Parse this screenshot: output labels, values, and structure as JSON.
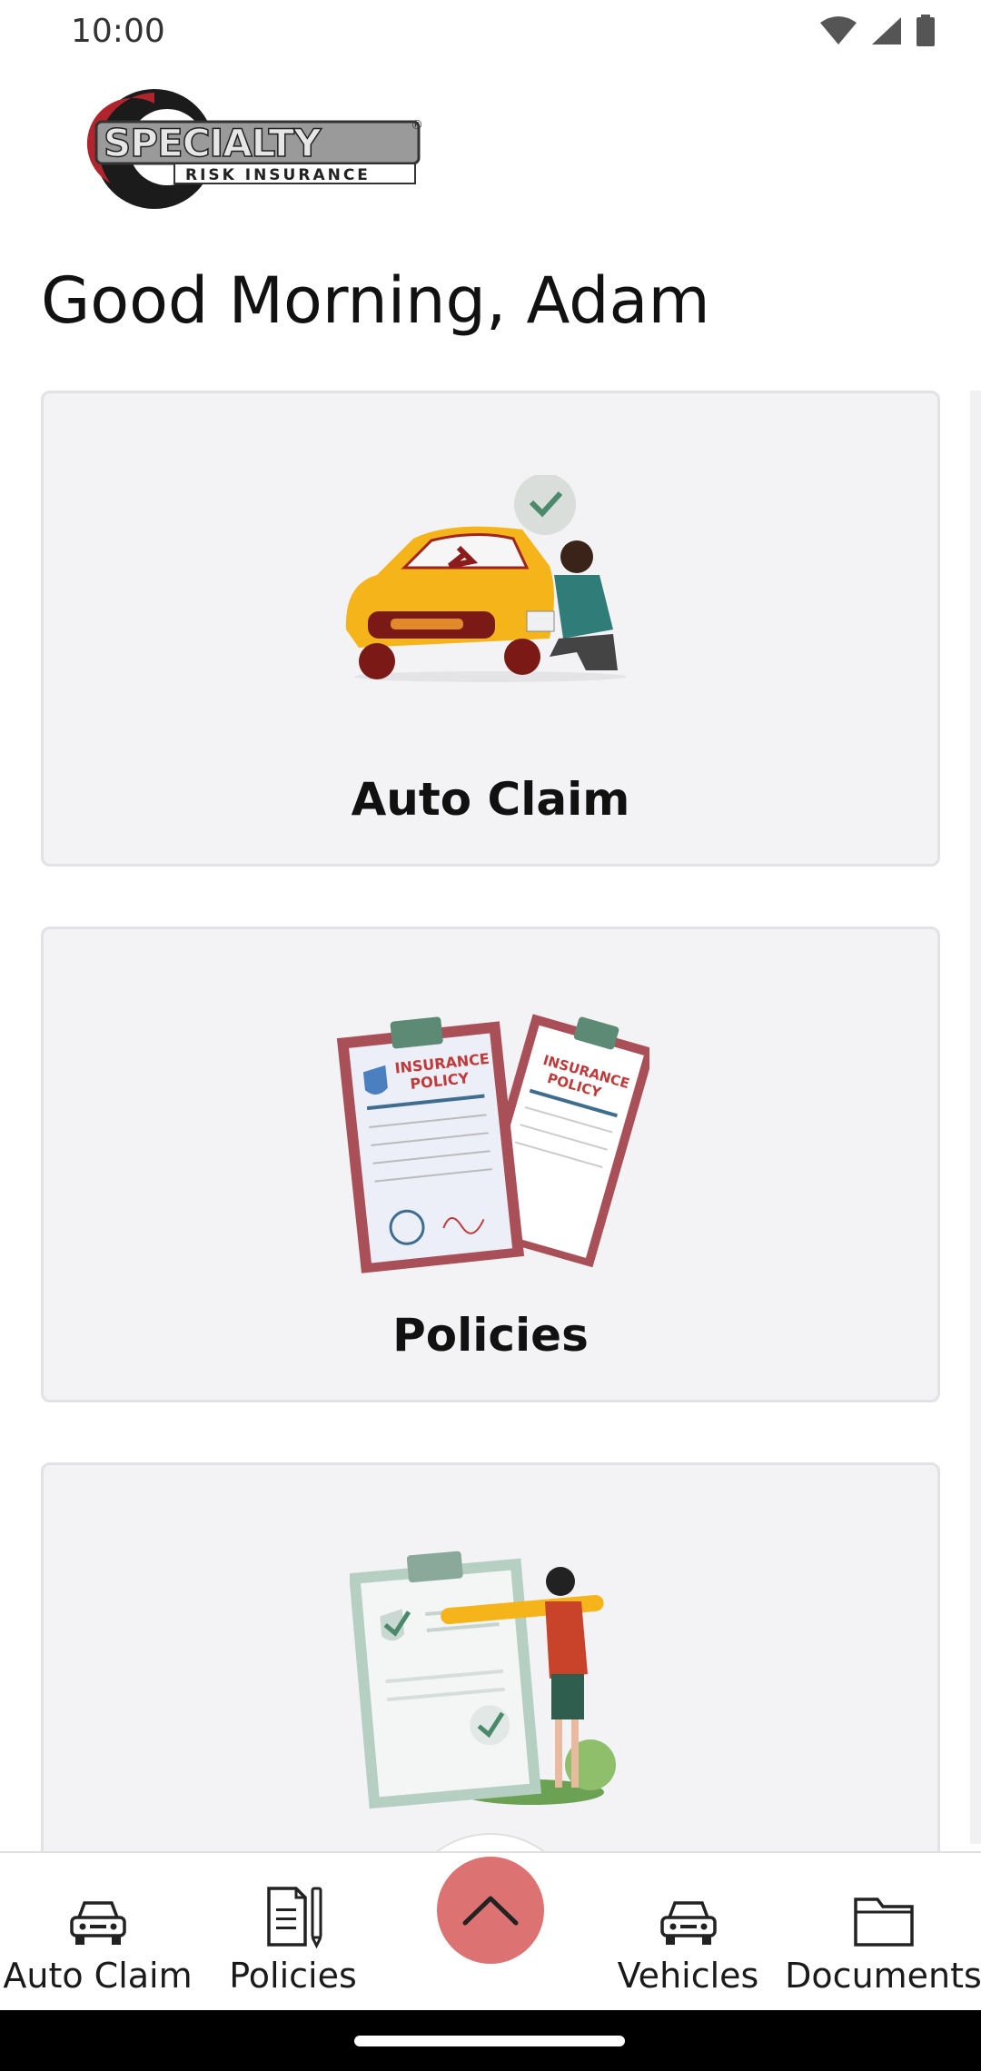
{
  "status_bar": {
    "time": "10:00",
    "icons": [
      "wifi-icon",
      "signal-icon",
      "battery-icon"
    ]
  },
  "logo": {
    "brand_main": "SPECIALTY",
    "brand_sub": "RISK INSURANCE",
    "registered": "®"
  },
  "greeting": "Good Morning, Adam",
  "cards": [
    {
      "label": "Auto Claim",
      "illustration": "car-inspection-illustration"
    },
    {
      "label": "Policies",
      "illustration": "insurance-policy-illustration",
      "doc_title_line1": "INSURANCE",
      "doc_title_line2": "POLICY"
    },
    {
      "label": "",
      "illustration": "checklist-illustration"
    }
  ],
  "bottom_nav": {
    "items": [
      {
        "label": "Auto Claim",
        "icon": "car-icon"
      },
      {
        "label": "Policies",
        "icon": "document-pen-icon"
      },
      {
        "label": "Vehicles",
        "icon": "car-icon"
      },
      {
        "label": "Documents",
        "icon": "folder-icon"
      }
    ],
    "fab_icon": "chevron-up-icon"
  },
  "colors": {
    "accent": "#dc7272",
    "card_bg": "#f3f3f5",
    "card_border": "#e2e2e6"
  }
}
